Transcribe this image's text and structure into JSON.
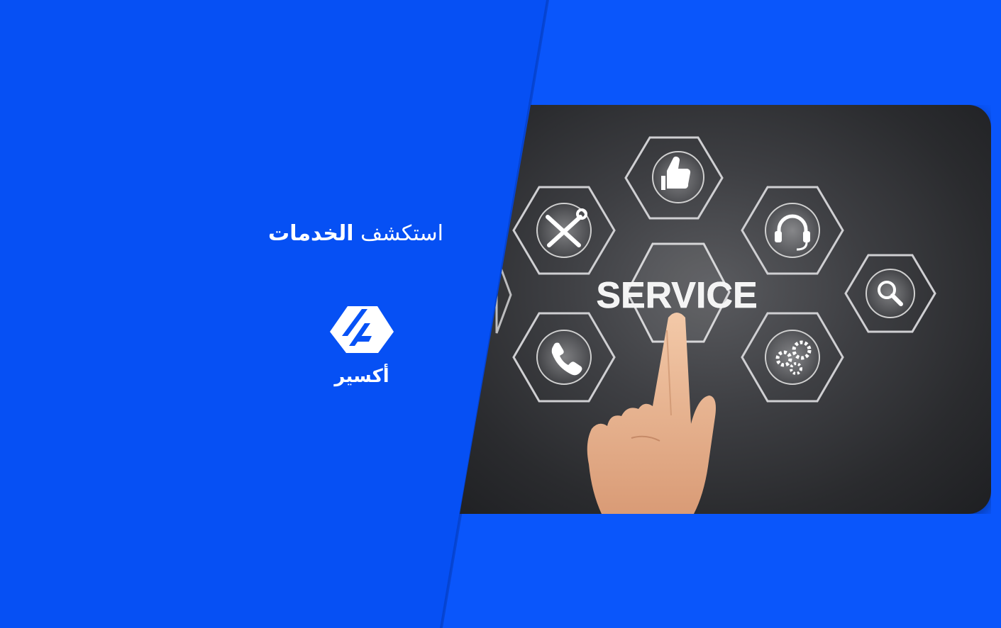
{
  "heading": {
    "light": "استكشف",
    "bold": "الخدمات"
  },
  "brand": {
    "name": "أكسير",
    "logo": "aksir-logo-icon"
  },
  "photo": {
    "headline": "SERVICE",
    "icons": [
      "thumbs-up-icon",
      "tools-icon",
      "headset-icon",
      "search-icon",
      "phone-icon",
      "gears-icon",
      "pointing-hand-icon"
    ]
  },
  "colors": {
    "background": "#0752f6",
    "text": "#ffffff"
  }
}
